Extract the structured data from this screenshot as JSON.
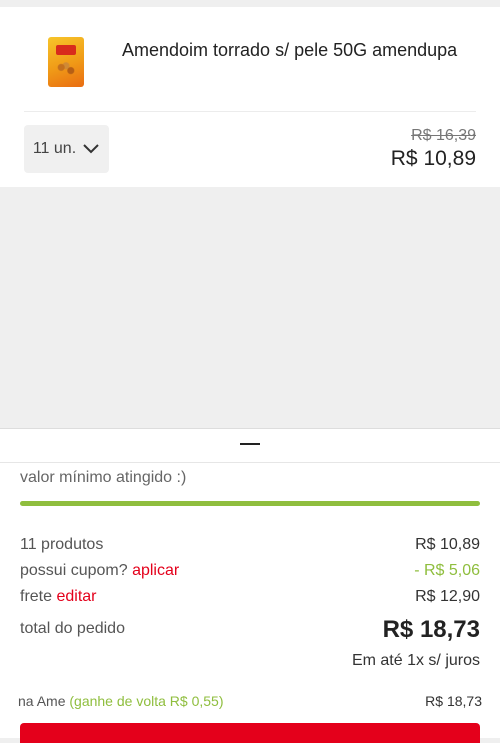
{
  "product": {
    "name": "Amendoim torrado s/ pele 50G amendupa",
    "image": "product-package-image",
    "quantity_label": "11 un.",
    "old_price": "R$ 16,39",
    "price": "R$ 10,89"
  },
  "summary": {
    "min_message": "valor mínimo atingido :)",
    "progress_fraction": 1.0,
    "products_label": "11 produtos",
    "products_value": "R$ 10,89",
    "coupon_label": "possui cupom?",
    "coupon_link": "aplicar",
    "coupon_value": "- R$ 5,06",
    "shipping_label": "frete",
    "shipping_link": "editar",
    "shipping_value": "R$ 12,90",
    "total_label": "total do pedido",
    "total_value": "R$ 18,73",
    "installments": "Em até 1x s/ juros",
    "ame_label": "na Ame",
    "ame_cashback": "(ganhe de volta R$ 0,55)",
    "ame_value": "R$ 18,73"
  },
  "colors": {
    "accent_red": "#e4001b",
    "accent_green": "#8fbe3e"
  }
}
